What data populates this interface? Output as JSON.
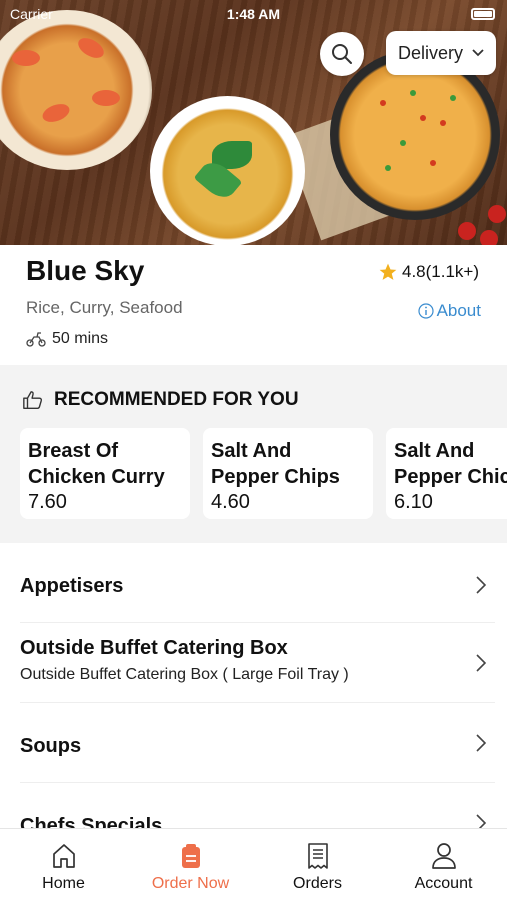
{
  "status_bar": {
    "carrier": "Carrier",
    "time": "1:48 AM"
  },
  "header": {
    "delivery_label": "Delivery"
  },
  "restaurant": {
    "name": "Blue Sky",
    "rating": "4.8(1.1k+)",
    "cuisines": "Rice, Curry, Seafood",
    "about_label": "About",
    "delivery_time": "50 mins"
  },
  "recommended": {
    "heading": "RECOMMENDED FOR YOU",
    "items": [
      {
        "name_line1": "Breast Of",
        "name_line2": "Chicken Curry",
        "price": "7.60"
      },
      {
        "name_line1": "Salt And",
        "name_line2": "Pepper Chips",
        "price": "4.60"
      },
      {
        "name_line1": "Salt And",
        "name_line2": "Pepper Chic",
        "price": "6.10"
      }
    ]
  },
  "categories": [
    {
      "title": "Appetisers",
      "subtitle": ""
    },
    {
      "title": "Outside Buffet Catering Box",
      "subtitle": "Outside Buffet Catering Box ( Large Foil Tray )"
    },
    {
      "title": "Soups",
      "subtitle": ""
    },
    {
      "title": "Chefs Specials",
      "subtitle": ""
    }
  ],
  "tabs": [
    {
      "label": "Home",
      "icon": "home-icon"
    },
    {
      "label": "Order Now",
      "icon": "order-bag-icon"
    },
    {
      "label": "Orders",
      "icon": "receipt-icon"
    },
    {
      "label": "Account",
      "icon": "user-icon"
    }
  ],
  "colors": {
    "accent": "#ee6f4a",
    "link": "#3a8ccf",
    "star": "#f2b01e",
    "section_bg": "#f3f3f3"
  }
}
